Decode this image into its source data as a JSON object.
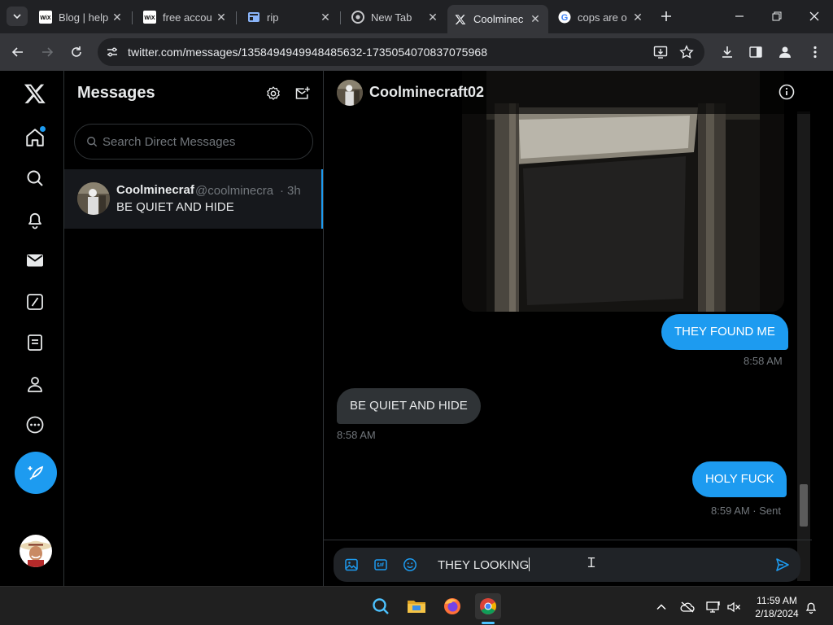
{
  "browser": {
    "tabs": [
      {
        "title": "Blog | help",
        "favicon": "wix-icon"
      },
      {
        "title": "free accou",
        "favicon": "wix-icon"
      },
      {
        "title": "rip",
        "favicon": "page-icon"
      },
      {
        "title": "New Tab",
        "favicon": "chrome-icon"
      },
      {
        "title": "Coolminec",
        "favicon": "x-logo-icon",
        "active": true
      },
      {
        "title": "cops are o",
        "favicon": "google-icon"
      }
    ],
    "url": "twitter.com/messages/1358494949948485632-1735054070837075968"
  },
  "messages_panel": {
    "title": "Messages",
    "search_placeholder": "Search Direct Messages",
    "conversations": [
      {
        "name": "Coolminecraf",
        "handle": "@coolminecra",
        "separator": "·",
        "time": "3h",
        "preview": "BE QUIET AND HIDE"
      }
    ]
  },
  "chat": {
    "contact_name": "Coolminecraft02",
    "messages": [
      {
        "from": "me",
        "text": "THEY FOUND ME",
        "stamp": "8:58 AM"
      },
      {
        "from": "them",
        "text": "BE QUIET AND HIDE",
        "stamp": "8:58 AM"
      },
      {
        "from": "me",
        "text": "HOLY FUCK",
        "stamp": "8:59 AM · Sent"
      }
    ],
    "composer_value": "THEY LOOKING"
  },
  "taskbar": {
    "time": "11:59 AM",
    "date": "2/18/2024"
  },
  "colors": {
    "accent": "#1d9bf0",
    "background": "#000000",
    "bubble_them": "#2f3336"
  }
}
